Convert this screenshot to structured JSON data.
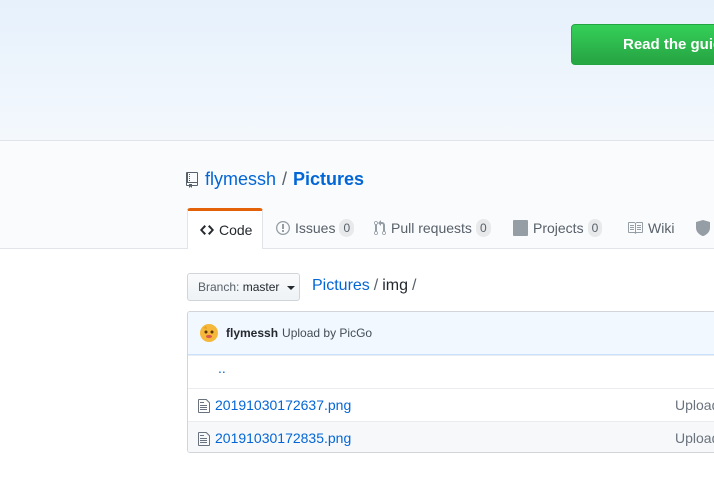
{
  "hero": {
    "guide_button": "Read the guide"
  },
  "repo": {
    "owner": "flymessh",
    "separator": "/",
    "name": "Pictures"
  },
  "tabs": [
    {
      "label": "Code",
      "icon": "code-icon",
      "selected": true
    },
    {
      "label": "Issues",
      "icon": "issue-icon",
      "count": "0"
    },
    {
      "label": "Pull requests",
      "icon": "pull-request-icon",
      "count": "0"
    },
    {
      "label": "Projects",
      "icon": "project-icon",
      "count": "0"
    },
    {
      "label": "Wiki",
      "icon": "book-icon"
    }
  ],
  "branch": {
    "prefix": "Branch:",
    "name": "master"
  },
  "breadcrumb": {
    "root": "Pictures",
    "dir": "img",
    "slash": "/"
  },
  "commit": {
    "author": "flymessh",
    "message": "Upload by PicGo"
  },
  "files": {
    "updir": "..",
    "rows": [
      {
        "name": "20191030172637.png",
        "message": "Upload by PicGo"
      },
      {
        "name": "20191030172835.png",
        "message": "Upload by PicGo"
      }
    ]
  },
  "colors": {
    "accent": "#0366d6",
    "tab_highlight": "#e36209",
    "button_green": "#28a745"
  }
}
